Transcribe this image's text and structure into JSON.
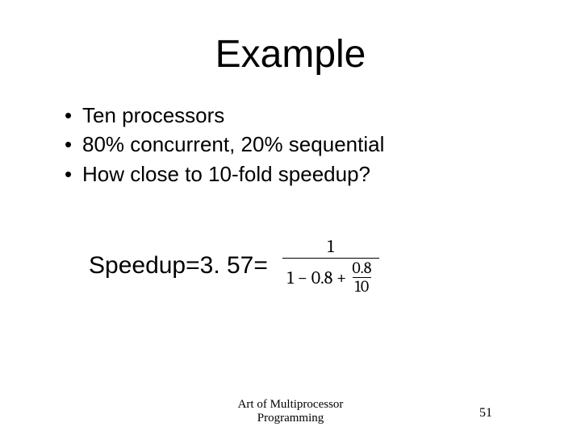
{
  "title": "Example",
  "bullets": [
    "Ten processors",
    "80% concurrent, 20% sequential",
    "How close to 10-fold speedup?"
  ],
  "speedup": {
    "label": "Speedup=3. 57=",
    "numerator": "1",
    "denom_prefix": "1 − 0.8 +",
    "inner_num": "0.8",
    "inner_den": "10"
  },
  "footer": "Art of Multiprocessor Programming",
  "page": "51"
}
